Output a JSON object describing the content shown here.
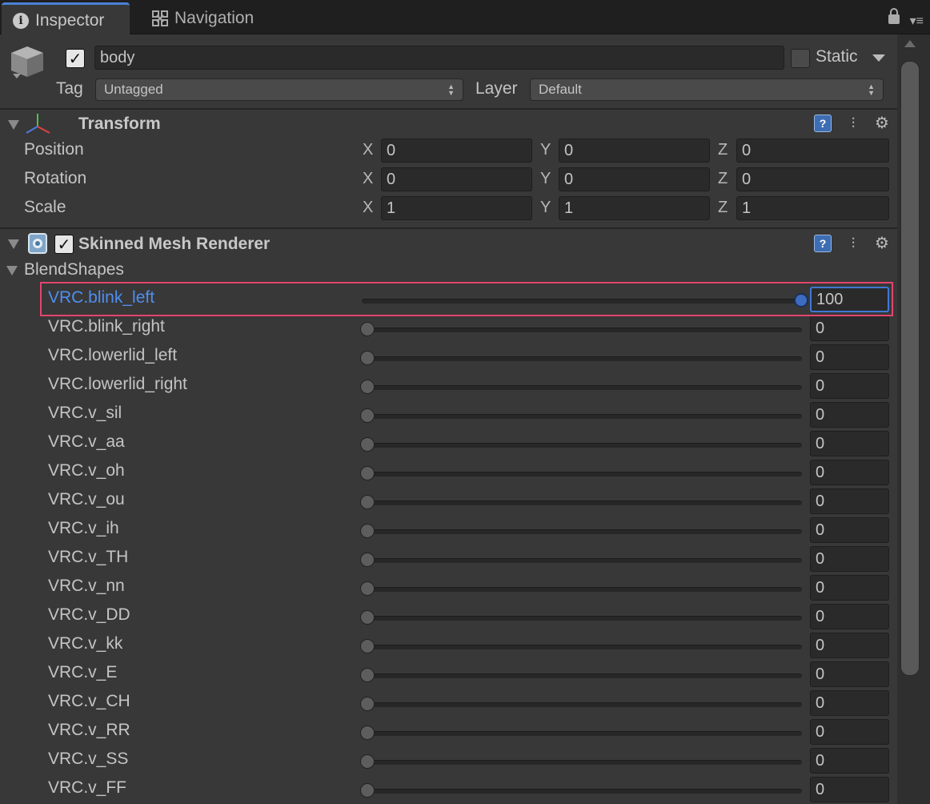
{
  "tabs": [
    {
      "label": "Inspector",
      "icon": "info-icon"
    },
    {
      "label": "Navigation",
      "icon": "navigation-icon"
    }
  ],
  "gameobject": {
    "name": "body",
    "active": true,
    "static_label": "Static",
    "static": false,
    "tag_label": "Tag",
    "tag_value": "Untagged",
    "layer_label": "Layer",
    "layer_value": "Default"
  },
  "transform": {
    "title": "Transform",
    "rows": [
      {
        "label": "Position",
        "x": "0",
        "y": "0",
        "z": "0"
      },
      {
        "label": "Rotation",
        "x": "0",
        "y": "0",
        "z": "0"
      },
      {
        "label": "Scale",
        "x": "1",
        "y": "1",
        "z": "1"
      }
    ],
    "axis_labels": [
      "X",
      "Y",
      "Z"
    ]
  },
  "skinned_mesh": {
    "title": "Skinned Mesh Renderer",
    "enabled": true,
    "blendshapes_label": "BlendShapes",
    "blendshapes": [
      {
        "name": "VRC.blink_left",
        "value": "100",
        "selected": true,
        "fraction": 1.0
      },
      {
        "name": "VRC.blink_right",
        "value": "0",
        "fraction": 0
      },
      {
        "name": "VRC.lowerlid_left",
        "value": "0",
        "fraction": 0
      },
      {
        "name": "VRC.lowerlid_right",
        "value": "0",
        "fraction": 0
      },
      {
        "name": "VRC.v_sil",
        "value": "0",
        "fraction": 0
      },
      {
        "name": "VRC.v_aa",
        "value": "0",
        "fraction": 0
      },
      {
        "name": "VRC.v_oh",
        "value": "0",
        "fraction": 0
      },
      {
        "name": "VRC.v_ou",
        "value": "0",
        "fraction": 0
      },
      {
        "name": "VRC.v_ih",
        "value": "0",
        "fraction": 0
      },
      {
        "name": "VRC.v_TH",
        "value": "0",
        "fraction": 0
      },
      {
        "name": "VRC.v_nn",
        "value": "0",
        "fraction": 0
      },
      {
        "name": "VRC.v_DD",
        "value": "0",
        "fraction": 0
      },
      {
        "name": "VRC.v_kk",
        "value": "0",
        "fraction": 0
      },
      {
        "name": "VRC.v_E",
        "value": "0",
        "fraction": 0
      },
      {
        "name": "VRC.v_CH",
        "value": "0",
        "fraction": 0
      },
      {
        "name": "VRC.v_RR",
        "value": "0",
        "fraction": 0
      },
      {
        "name": "VRC.v_SS",
        "value": "0",
        "fraction": 0
      },
      {
        "name": "VRC.v_FF",
        "value": "0",
        "fraction": 0
      }
    ]
  },
  "colors": {
    "selected_label": "#4f8ef0",
    "highlight_border": "#e2456e",
    "accent": "#3f78d4"
  }
}
